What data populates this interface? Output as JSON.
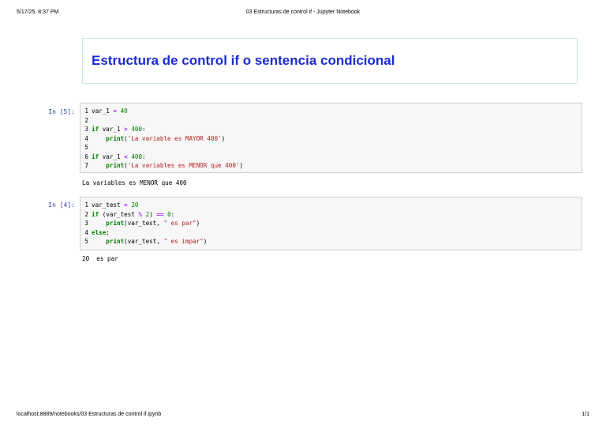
{
  "print_header": {
    "datetime": "5/17/25, 8:37 PM",
    "page_title": "03 Estructuras de control if - Jupyter Notebook"
  },
  "print_footer": {
    "url": "localhost:8889/notebooks/03 Estructuras de control if.ipynb",
    "page_number": "1/1"
  },
  "markdown_cell": {
    "heading": "Estructura de control if o sentencia condicional"
  },
  "cells": [
    {
      "prompt": "In [5]:",
      "output": "La variables es MENOR que 400",
      "lines": [
        {
          "n": "1",
          "tokens": [
            [
              "nm",
              "var_1 "
            ],
            [
              "op",
              "="
            ],
            [
              "nm",
              " "
            ],
            [
              "num",
              "40"
            ]
          ]
        },
        {
          "n": "2",
          "tokens": []
        },
        {
          "n": "3",
          "tokens": [
            [
              "kw",
              "if"
            ],
            [
              "nm",
              " var_1 "
            ],
            [
              "op",
              ">"
            ],
            [
              "nm",
              " "
            ],
            [
              "num",
              "400"
            ],
            [
              "nm",
              ":"
            ]
          ]
        },
        {
          "n": "4",
          "tokens": [
            [
              "nm",
              "    "
            ],
            [
              "kw",
              "print"
            ],
            [
              "nm",
              "("
            ],
            [
              "str",
              "'La variable es MAYOR 400'"
            ],
            [
              "nm",
              ")"
            ]
          ]
        },
        {
          "n": "5",
          "tokens": []
        },
        {
          "n": "6",
          "tokens": [
            [
              "kw",
              "if"
            ],
            [
              "nm",
              " var_1 "
            ],
            [
              "op",
              "<"
            ],
            [
              "nm",
              " "
            ],
            [
              "num",
              "400"
            ],
            [
              "nm",
              ":"
            ]
          ]
        },
        {
          "n": "7",
          "tokens": [
            [
              "nm",
              "    "
            ],
            [
              "kw",
              "print"
            ],
            [
              "nm",
              "("
            ],
            [
              "str",
              "'La variables es MENOR que 400'"
            ],
            [
              "nm",
              ")"
            ]
          ]
        }
      ]
    },
    {
      "prompt": "In [4]:",
      "output": "20  es par",
      "lines": [
        {
          "n": "1",
          "tokens": [
            [
              "nm",
              "var_test "
            ],
            [
              "op",
              "="
            ],
            [
              "nm",
              " "
            ],
            [
              "num",
              "20"
            ]
          ]
        },
        {
          "n": "2",
          "tokens": [
            [
              "kw",
              "if"
            ],
            [
              "nm",
              " (var_test "
            ],
            [
              "op",
              "%"
            ],
            [
              "nm",
              " "
            ],
            [
              "num",
              "2"
            ],
            [
              "nm",
              ") "
            ],
            [
              "op",
              "=="
            ],
            [
              "nm",
              " "
            ],
            [
              "num",
              "0"
            ],
            [
              "nm",
              ":"
            ]
          ]
        },
        {
          "n": "3",
          "tokens": [
            [
              "nm",
              "    "
            ],
            [
              "kw",
              "print"
            ],
            [
              "nm",
              "(var_test, "
            ],
            [
              "str",
              "\" es par\""
            ],
            [
              "nm",
              ")"
            ]
          ]
        },
        {
          "n": "4",
          "tokens": [
            [
              "kw",
              "else"
            ],
            [
              "nm",
              ":"
            ]
          ]
        },
        {
          "n": "5",
          "tokens": [
            [
              "nm",
              "    "
            ],
            [
              "kw",
              "print"
            ],
            [
              "nm",
              "(var_test, "
            ],
            [
              "str",
              "\" es impar\""
            ],
            [
              "nm",
              ")"
            ]
          ]
        }
      ]
    }
  ]
}
